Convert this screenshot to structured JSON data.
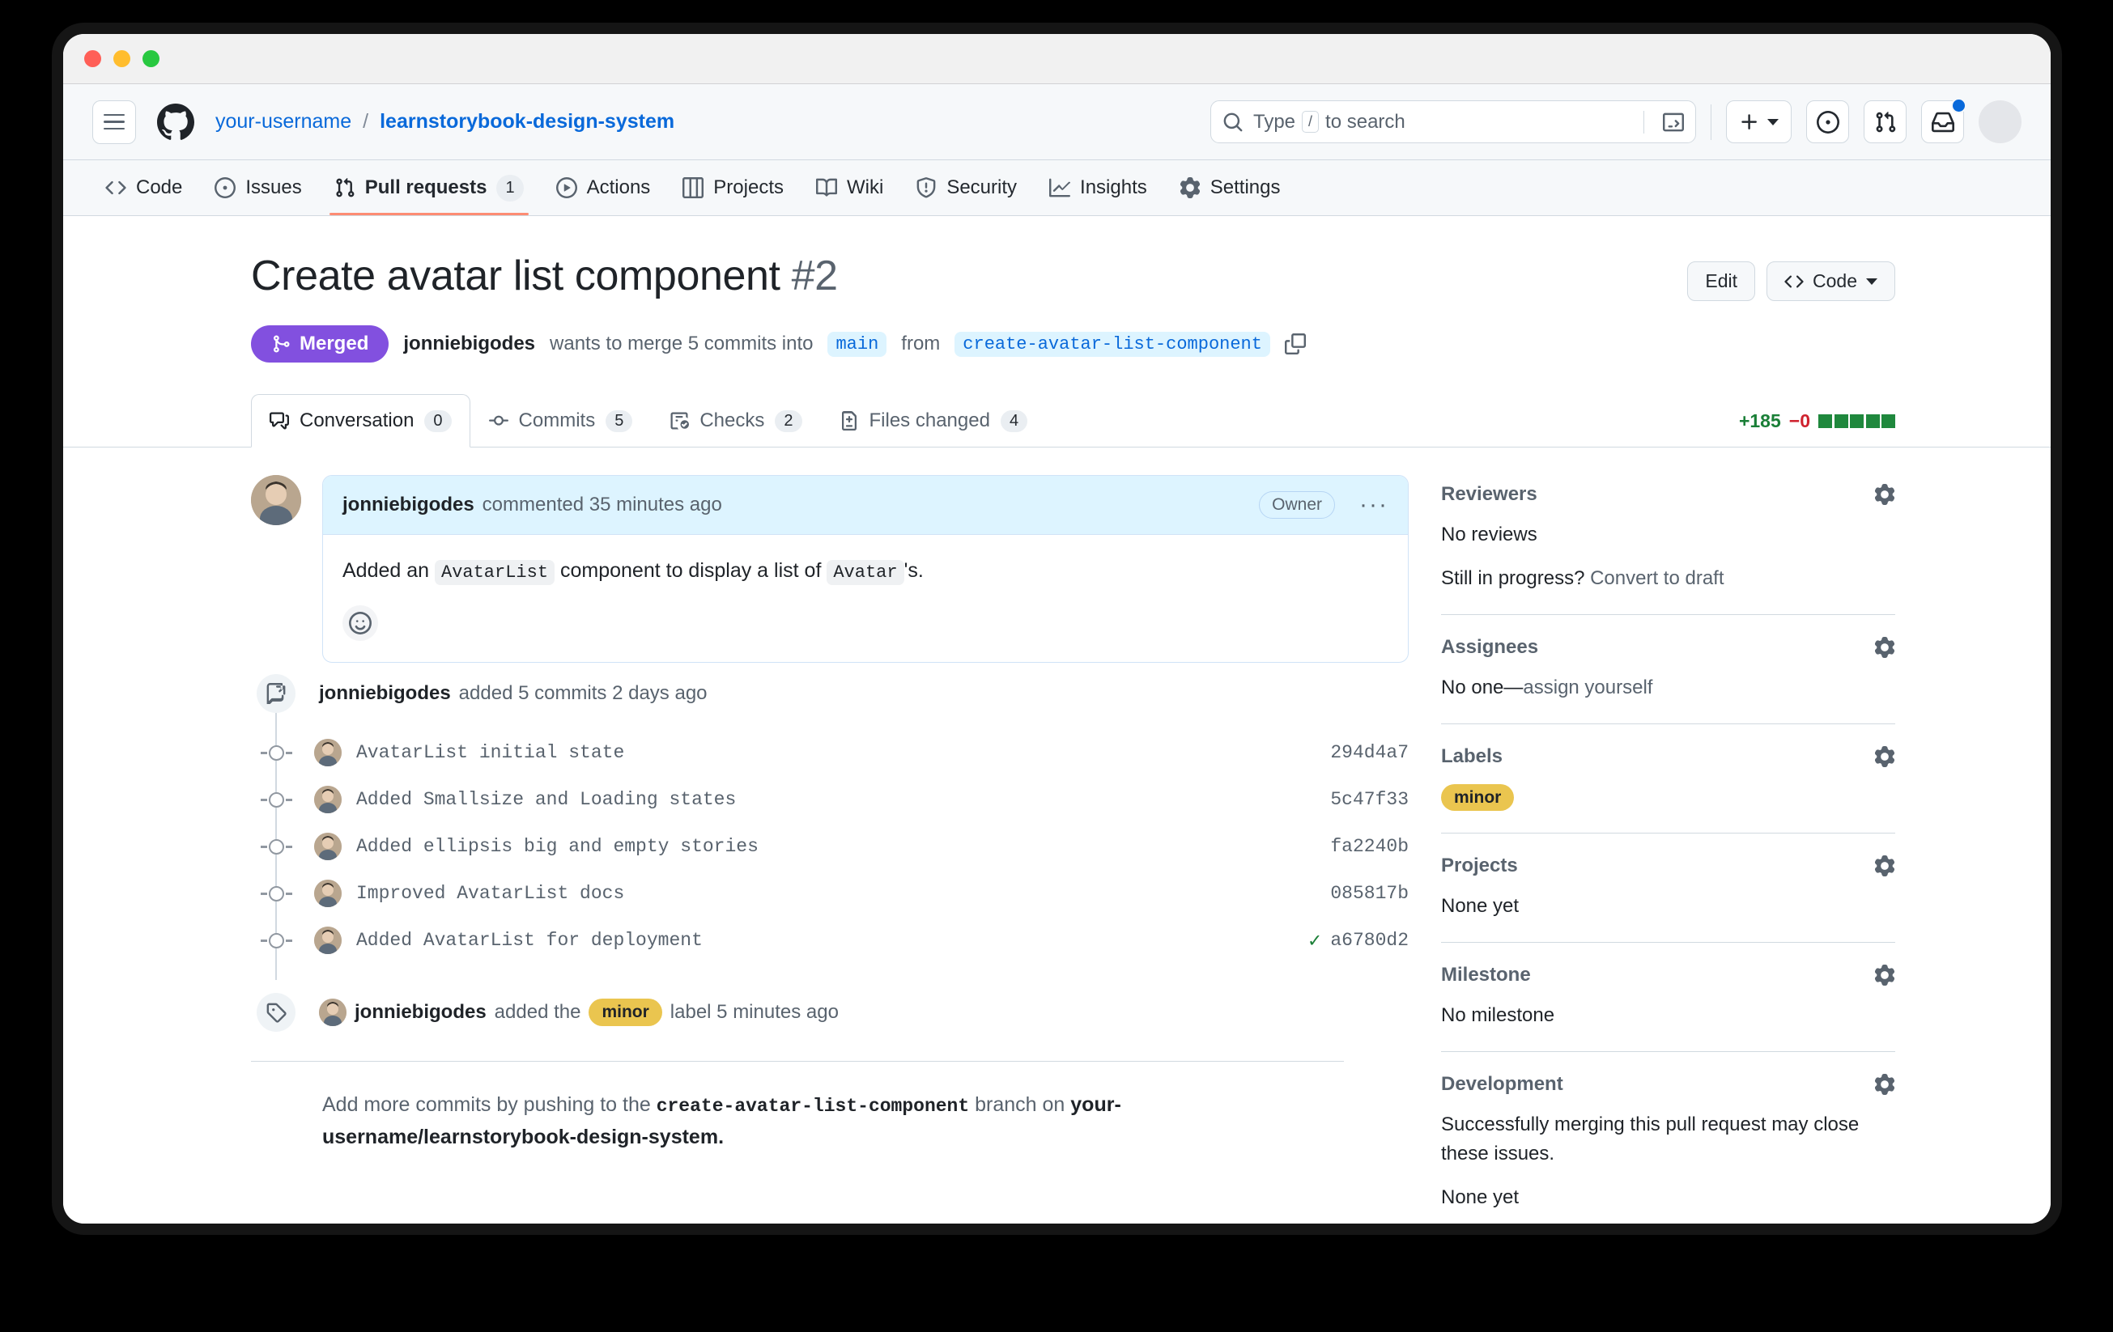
{
  "window": {
    "traffic_lights": [
      "close",
      "minimize",
      "maximize"
    ]
  },
  "header": {
    "owner": "your-username",
    "separator": "/",
    "repo": "learnstorybook-design-system",
    "search": {
      "placeholder": "Type",
      "slash_key": "/",
      "placeholder_tail": "to search"
    },
    "icons": {
      "hamburger": "hamburger-icon",
      "logo": "github-logo-icon",
      "search": "search-icon",
      "terminal": "terminal-icon",
      "plus": "plus-icon",
      "issue": "issue-opened-icon",
      "pull_request": "pull-request-icon",
      "inbox": "inbox-icon",
      "avatar": "user-avatar"
    }
  },
  "nav": {
    "items": [
      {
        "label": "Code",
        "icon": "code-icon",
        "count": "",
        "active": false
      },
      {
        "label": "Issues",
        "icon": "issue-opened-icon",
        "count": "",
        "active": false
      },
      {
        "label": "Pull requests",
        "icon": "git-pull-request-icon",
        "count": "1",
        "active": true
      },
      {
        "label": "Actions",
        "icon": "play-icon",
        "count": "",
        "active": false
      },
      {
        "label": "Projects",
        "icon": "table-icon",
        "count": "",
        "active": false
      },
      {
        "label": "Wiki",
        "icon": "book-icon",
        "count": "",
        "active": false
      },
      {
        "label": "Security",
        "icon": "shield-icon",
        "count": "",
        "active": false
      },
      {
        "label": "Insights",
        "icon": "graph-icon",
        "count": "",
        "active": false
      },
      {
        "label": "Settings",
        "icon": "gear-icon",
        "count": "",
        "active": false
      }
    ]
  },
  "pull_request": {
    "title": "Create avatar list component",
    "number": "#2",
    "edit_label": "Edit",
    "code_label": "Code",
    "status_badge": "Merged",
    "status_color": "#8250df",
    "author": "jonniebigodes",
    "merge_text_1": "wants to merge 5 commits into",
    "base_branch": "main",
    "merge_text_2": "from",
    "head_branch": "create-avatar-list-component",
    "tabs": [
      {
        "label": "Conversation",
        "count": "0",
        "icon": "comment-icon",
        "active": true
      },
      {
        "label": "Commits",
        "count": "5",
        "icon": "commit-icon",
        "active": false
      },
      {
        "label": "Checks",
        "count": "2",
        "icon": "checklist-icon",
        "active": false
      },
      {
        "label": "Files changed",
        "count": "4",
        "icon": "file-diff-icon",
        "active": false
      }
    ],
    "diffstat": {
      "additions": "+185",
      "deletions": "−0",
      "squares_on": 5,
      "squares_off": 0
    }
  },
  "comment": {
    "author": "jonniebigodes",
    "action": "commented 35 minutes ago",
    "badge": "Owner",
    "menu": "···",
    "body_pre": "Added an",
    "body_code_1": "AvatarList",
    "body_mid": "component to display a list of",
    "body_code_2": "Avatar",
    "body_post": "'s.",
    "reaction_icon": "smiley-icon"
  },
  "timeline": {
    "commits_event": {
      "icon": "repo-push-icon",
      "author": "jonniebigodes",
      "text": "added 5 commits 2 days ago"
    },
    "commits": [
      {
        "message": "AvatarList initial state",
        "sha": "294d4a7",
        "status": ""
      },
      {
        "message": "Added Smallsize and Loading states",
        "sha": "5c47f33",
        "status": ""
      },
      {
        "message": "Added ellipsis big and empty stories",
        "sha": "fa2240b",
        "status": ""
      },
      {
        "message": "Improved AvatarList docs",
        "sha": "085817b",
        "status": ""
      },
      {
        "message": "Added AvatarList for deployment",
        "sha": "a6780d2",
        "status": "check"
      }
    ],
    "label_event": {
      "icon": "tag-icon",
      "author": "jonniebigodes",
      "text_pre": "added the",
      "label": "minor",
      "text_post": "label 5 minutes ago"
    }
  },
  "push_note": {
    "pre": "Add more commits by pushing to the",
    "branch": "create-avatar-list-component",
    "mid": "branch on",
    "repo": "your-username/learnstorybook-design-system",
    "post": "."
  },
  "sidebar": {
    "sections": [
      {
        "title": "Reviewers",
        "gear": "gear-icon",
        "lines": [
          {
            "text": "No reviews",
            "type": "plain"
          },
          {
            "text": "Still in progress?",
            "link": "Convert to draft",
            "type": "link"
          }
        ]
      },
      {
        "title": "Assignees",
        "gear": "gear-icon",
        "lines": [
          {
            "text": "No one—",
            "link": "assign yourself",
            "type": "link"
          }
        ]
      },
      {
        "title": "Labels",
        "gear": "gear-icon",
        "lines": [],
        "label": "minor",
        "label_color": "#eac54f"
      },
      {
        "title": "Projects",
        "gear": "gear-icon",
        "lines": [
          {
            "text": "None yet",
            "type": "plain"
          }
        ]
      },
      {
        "title": "Milestone",
        "gear": "gear-icon",
        "lines": [
          {
            "text": "No milestone",
            "type": "plain"
          }
        ]
      },
      {
        "title": "Development",
        "gear": "gear-icon",
        "lines": [
          {
            "text": "Successfully merging this pull request may close these issues.",
            "type": "plain"
          },
          {
            "text": "None yet",
            "type": "plain"
          }
        ]
      }
    ]
  }
}
